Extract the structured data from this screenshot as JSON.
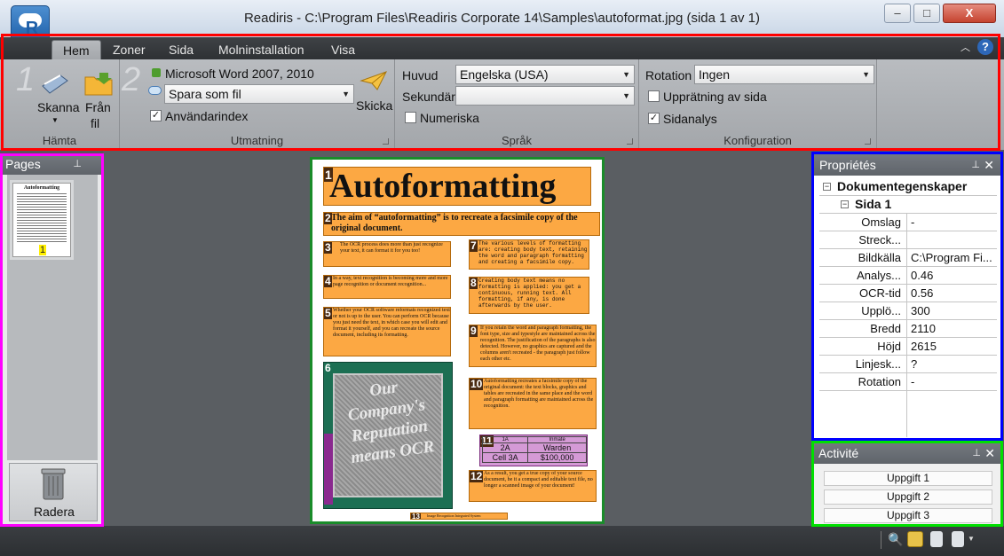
{
  "window": {
    "title": "Readiris - C:\\Program Files\\Readiris Corporate 14\\Samples\\autoformat.jpg (sida 1 av 1)",
    "minimize": "–",
    "maximize": "□",
    "close": "X",
    "app_icon_letter": "R"
  },
  "tabs": [
    "Hem",
    "Zoner",
    "Sida",
    "Molninstallation",
    "Visa"
  ],
  "help_icon": "?",
  "ribbon": {
    "hamta": {
      "step_number": "1",
      "scan_label": "Skanna",
      "from_file_label": "Från",
      "from_file_label2": "fil",
      "group_label": "Hämta"
    },
    "utmatning": {
      "step_number": "2",
      "format_label": "Microsoft Word 2007, 2010",
      "save_option": "Spara som fil",
      "user_index_label": "Användarindex",
      "user_index_checked": true,
      "send_label": "Skicka",
      "group_label": "Utmatning"
    },
    "sprak": {
      "main_label": "Huvud",
      "main_value": "Engelska (USA)",
      "secondary_label": "Sekundär",
      "secondary_value": "",
      "numeric_label": "Numeriska",
      "numeric_checked": false,
      "group_label": "Språk"
    },
    "konfiguration": {
      "rotation_label": "Rotation",
      "rotation_value": "Ingen",
      "deskew_label": "Upprätning av sida",
      "deskew_checked": false,
      "page_analysis_label": "Sidanalys",
      "page_analysis_checked": true,
      "group_label": "Konfiguration"
    }
  },
  "pages_panel": {
    "title": "Pages",
    "thumbnail_page_number": "1",
    "thumbnail_title": "Autoformatting",
    "delete_label": "Radera"
  },
  "document": {
    "blocks": [
      {
        "n": "1",
        "text": "Autoformatting"
      },
      {
        "n": "2",
        "text": "The aim of “autoformatting” is to recreate a facsimile copy of the original document."
      },
      {
        "n": "3",
        "text": "The OCR process does more than just recognize your text, it can format it for you too!"
      },
      {
        "n": "4",
        "text": "In a way, text recognition is becoming more and more page recognition or document recognition..."
      },
      {
        "n": "5",
        "text": "Whether your OCR software reformats recognized text or not is up to the user. You can perform OCR because you just need the text, in which case you will edit and format it yourself, and you can recreate the source document, including its formatting."
      },
      {
        "n": "6",
        "text": "Our Company's Reputation means OCR"
      },
      {
        "n": "7",
        "text": "The various levels of formatting are: creating body text, retaining the word and paragraph formatting and creating a facsimile copy."
      },
      {
        "n": "8",
        "text": "Creating body text means no formatting is applied: you get a continuous, running text. All formatting, if any, is done afterwards by the user."
      },
      {
        "n": "9",
        "text": "If you retain the word and paragraph formatting, the font type, size and typestyle are maintained across the recognition. The justification of the paragraphs is also detected. However, no graphics are captured and the columns aren't recreated - the paragraph just follow each other etc."
      },
      {
        "n": "10",
        "text": "Autoformatting recreates a facsimile copy of the original document: the text blocks, graphics and tables are recreated in the same place and the word and paragraph formatting are maintained across the recognition."
      },
      {
        "n": "11",
        "table": [
          [
            "1A",
            "Inmate"
          ],
          [
            "2A",
            "Warden"
          ],
          [
            "Cell 3A",
            "$100,000"
          ]
        ]
      },
      {
        "n": "12",
        "text": "As a result, you get a true copy of your source document, be it a compact and editable text file, no longer a scanned image of your document!"
      },
      {
        "n": "13",
        "text": "Image Recognition Integrated System"
      }
    ]
  },
  "properties_panel": {
    "title": "Propriétés",
    "root": "Dokumentegenskaper",
    "page_node": "Sida 1",
    "rows": [
      {
        "key": "Omslag",
        "value": "-"
      },
      {
        "key": "Streck...",
        "value": ""
      },
      {
        "key": "Bildkälla",
        "value": "C:\\Program Fi..."
      },
      {
        "key": "Analys...",
        "value": "0.46"
      },
      {
        "key": "OCR-tid",
        "value": "0.56"
      },
      {
        "key": "Upplö...",
        "value": "300"
      },
      {
        "key": "Bredd",
        "value": "2110"
      },
      {
        "key": "Höjd",
        "value": "2615"
      },
      {
        "key": "Linjesk...",
        "value": "?"
      },
      {
        "key": "Rotation",
        "value": "-"
      }
    ]
  },
  "activity_panel": {
    "title": "Activité",
    "tasks": [
      "Uppgift 1",
      "Uppgift 2",
      "Uppgift 3"
    ]
  },
  "colors": {
    "highlight_ribbon": "#ff0000",
    "highlight_pages": "#ff00ff",
    "highlight_document": "#1a8c2a",
    "highlight_properties": "#0000ff",
    "highlight_activity": "#00e000",
    "block_fill": "#fca843"
  }
}
